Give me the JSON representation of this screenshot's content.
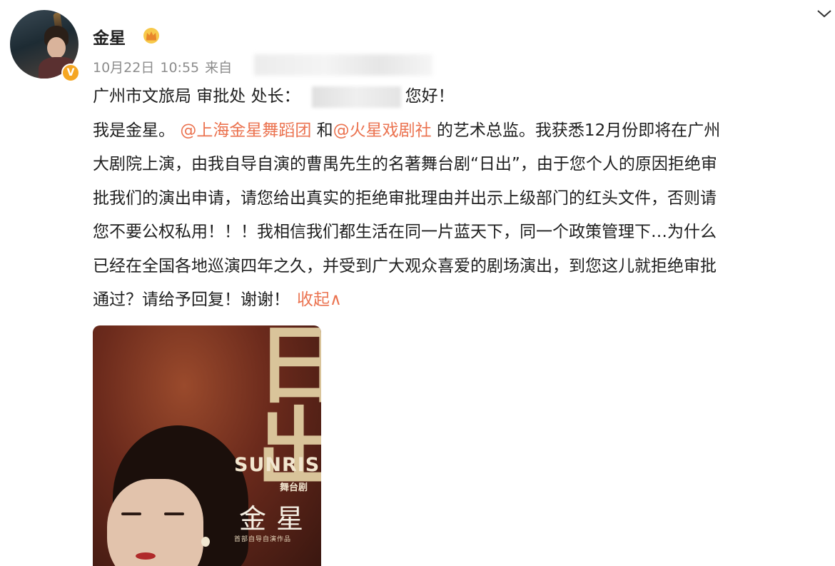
{
  "post": {
    "username": "金星",
    "date": "10月22日",
    "time": "10:55",
    "source_prefix": "来自",
    "badge": "V",
    "line1_a": "广州市文旅局 审批处 处长：",
    "line1_b": "您好！",
    "line2_a": "我是金星。",
    "mention1": "@上海金星舞蹈团",
    "line2_b": " 和",
    "mention2": "@火星戏剧社",
    "line2_c": " 的艺术总监。我获悉12月份即将在广州",
    "line3": "大剧院上演，由我自导自演的曹禺先生的名著舞台剧“日出”，由于您个人的原因拒绝审",
    "line4": "批我们的演出申请，请您给出真实的拒绝审批理由并出示上级部门的红头文件，否则请",
    "line5": "您不要公权私用！！！我相信我们都生活在同一片蓝天下，同一个政策管理下…为什么",
    "line6": "已经在全国各地巡演四年之久，并受到广大观众喜爱的剧场演出，到您这儿就拒绝审批",
    "line7": "通过？请给予回复！谢谢！",
    "collapse_label": "收起∧"
  },
  "poster": {
    "title_cn": "日出",
    "title_en": "SUNRISE",
    "subtitle": "舞台剧",
    "star": "金星",
    "credit": "首部自导自演作品"
  },
  "icons": {
    "crown": "crown-icon",
    "chevron": "chevron-down-icon"
  },
  "colors": {
    "accent": "#eb7350",
    "meta": "#8c8c8c",
    "verified": "#f5a623"
  }
}
